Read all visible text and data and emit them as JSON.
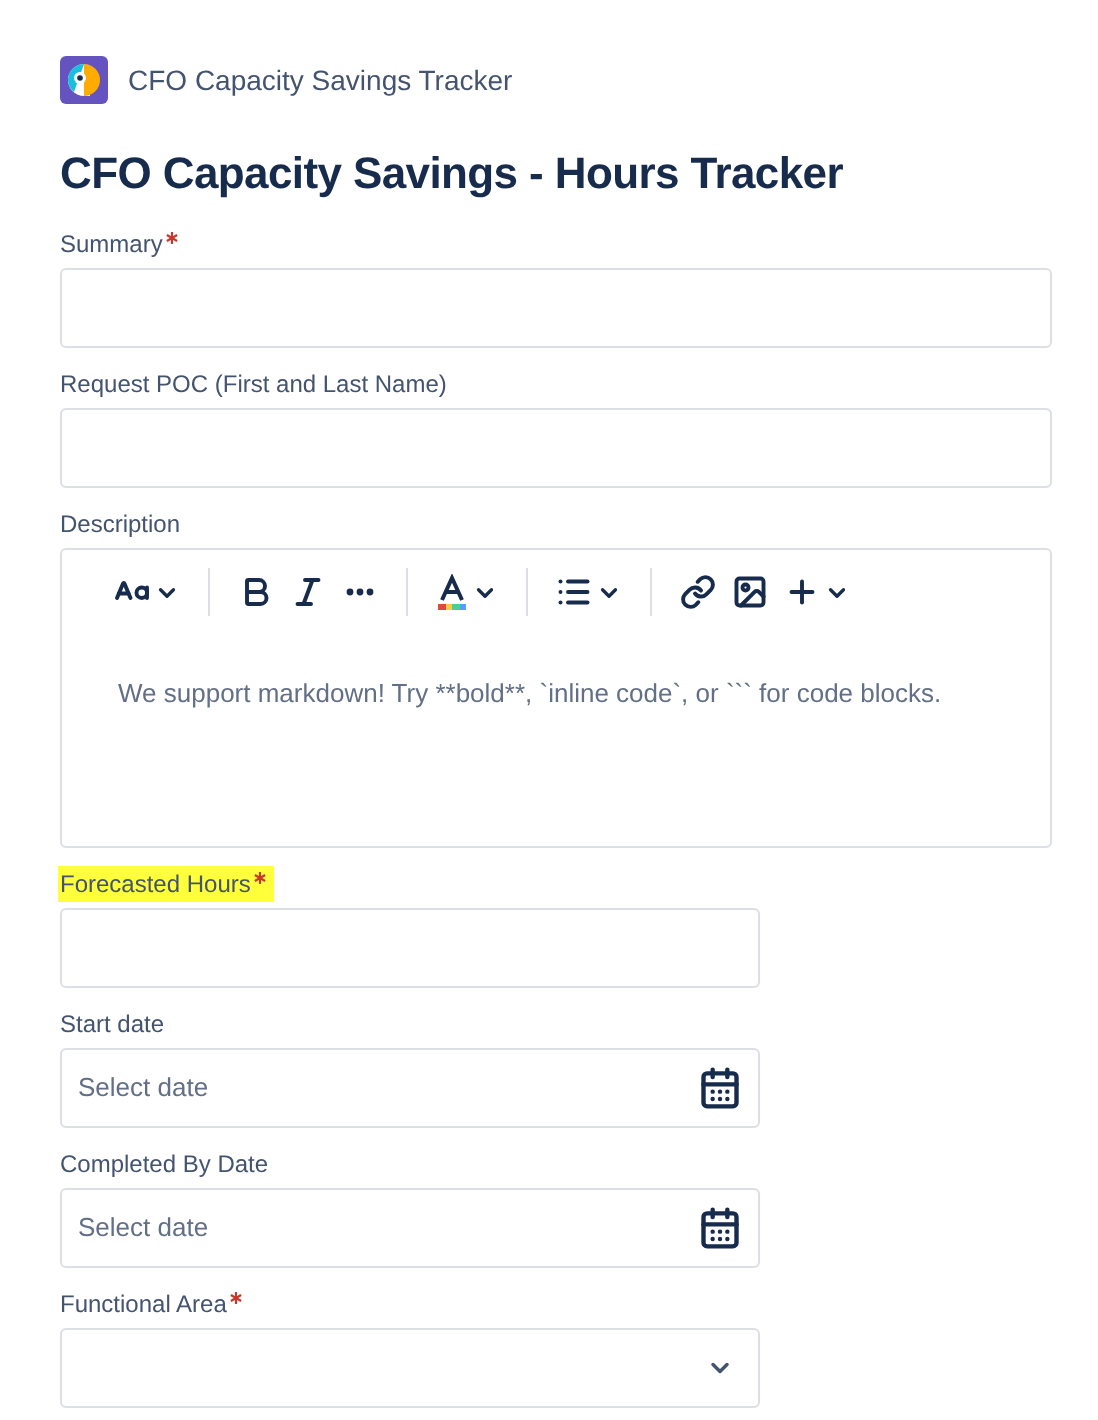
{
  "app": {
    "name": "CFO Capacity Savings Tracker"
  },
  "form": {
    "title": "CFO Capacity Savings - Hours Tracker",
    "fields": [
      {
        "kind": "text",
        "label": "Summary",
        "required": true,
        "highlighted": false
      },
      {
        "kind": "text",
        "label": "Request POC (First and Last Name)",
        "required": false,
        "highlighted": false
      },
      {
        "kind": "editor",
        "label": "Description",
        "required": false,
        "highlighted": false,
        "placeholder": "We support markdown! Try **bold**, `inline code`, or ``` for code blocks."
      },
      {
        "kind": "number",
        "label": "Forecasted Hours",
        "required": true,
        "highlighted": true
      },
      {
        "kind": "date",
        "label": "Start date",
        "required": false,
        "highlighted": false,
        "placeholder": "Select date"
      },
      {
        "kind": "date",
        "label": "Completed By Date",
        "required": false,
        "highlighted": false,
        "placeholder": "Select date"
      },
      {
        "kind": "select",
        "label": "Functional Area",
        "required": true,
        "highlighted": false
      }
    ]
  }
}
